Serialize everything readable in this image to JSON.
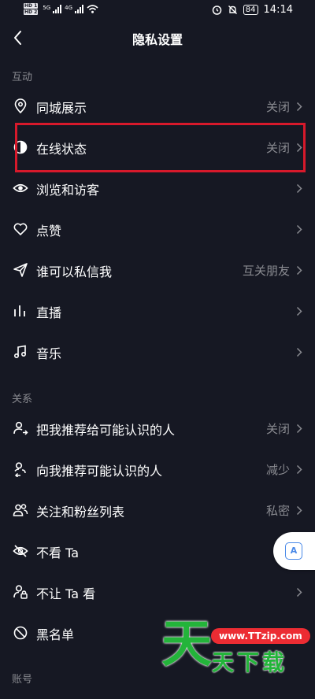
{
  "status_bar": {
    "hd1": "HD 1",
    "hd2": "HD 2",
    "net1": "5G",
    "net2": "4G",
    "battery": "84",
    "time": "14:14"
  },
  "header": {
    "title": "隐私设置"
  },
  "sections": {
    "interaction": "互动",
    "relations": "关系",
    "account": "账号"
  },
  "rows": [
    {
      "label": "同城展示",
      "value": "关闭",
      "icon": "location-pin-icon"
    },
    {
      "label": "在线状态",
      "value": "关闭",
      "icon": "online-status-icon"
    },
    {
      "label": "浏览和访客",
      "value": "",
      "icon": "eye-icon"
    },
    {
      "label": "点赞",
      "value": "",
      "icon": "heart-icon"
    },
    {
      "label": "谁可以私信我",
      "value": "互关朋友",
      "icon": "send-icon"
    },
    {
      "label": "直播",
      "value": "",
      "icon": "live-bars-icon"
    },
    {
      "label": "音乐",
      "value": "",
      "icon": "music-note-icon"
    },
    {
      "label": "把我推荐给可能认识的人",
      "value": "关闭",
      "icon": "user-share-icon"
    },
    {
      "label": "向我推荐可能认识的人",
      "value": "减少",
      "icon": "user-recommend-icon"
    },
    {
      "label": "关注和粉丝列表",
      "value": "私密",
      "icon": "users-icon"
    },
    {
      "label": "不看 Ta",
      "value": "",
      "icon": "eye-off-icon"
    },
    {
      "label": "不让 Ta 看",
      "value": "",
      "icon": "user-lock-icon"
    },
    {
      "label": "黑名单",
      "value": "",
      "icon": "block-icon"
    }
  ],
  "floating_button": {
    "text": "A"
  },
  "watermark": {
    "big": "天",
    "url": "www.TTzip.com",
    "small": "天下载"
  }
}
